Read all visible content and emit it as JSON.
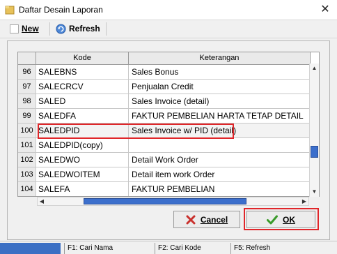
{
  "window": {
    "title": "Daftar Desain Laporan",
    "close_glyph": "✕"
  },
  "toolbar": {
    "new_label": "New",
    "refresh_label": "Refresh"
  },
  "grid": {
    "columns": {
      "kode": "Kode",
      "keterangan": "Keterangan"
    },
    "rows": [
      {
        "no": "96",
        "kode": "SALEBNS",
        "keterangan": "Sales Bonus"
      },
      {
        "no": "97",
        "kode": "SALECRCV",
        "keterangan": "Penjualan Credit"
      },
      {
        "no": "98",
        "kode": "SALED",
        "keterangan": "Sales Invoice (detail)"
      },
      {
        "no": "99",
        "kode": "SALEDFA",
        "keterangan": "FAKTUR PEMBELIAN HARTA TETAP DETAIL"
      },
      {
        "no": "100",
        "kode": "SALEDPID",
        "keterangan": "Sales Invoice w/ PID (detail)"
      },
      {
        "no": "101",
        "kode": "SALEDPID(copy)",
        "keterangan": ""
      },
      {
        "no": "102",
        "kode": "SALEDWO",
        "keterangan": "Detail Work Order"
      },
      {
        "no": "103",
        "kode": "SALEDWOITEM",
        "keterangan": "Detail item work Order"
      },
      {
        "no": "104",
        "kode": "SALEFA",
        "keterangan": "FAKTUR PEMBELIAN"
      }
    ],
    "selected_row": "100"
  },
  "buttons": {
    "cancel_label": "Cancel",
    "ok_label": "OK"
  },
  "statusbar": {
    "f1": "F1: Cari Nama",
    "f2": "F2: Cari Kode",
    "f5": "F5: Refresh"
  },
  "colors": {
    "highlight": "#e0262a",
    "accent": "#3b6fc4",
    "ok_check": "#3a9a2a",
    "cancel_x": "#c9302c"
  }
}
